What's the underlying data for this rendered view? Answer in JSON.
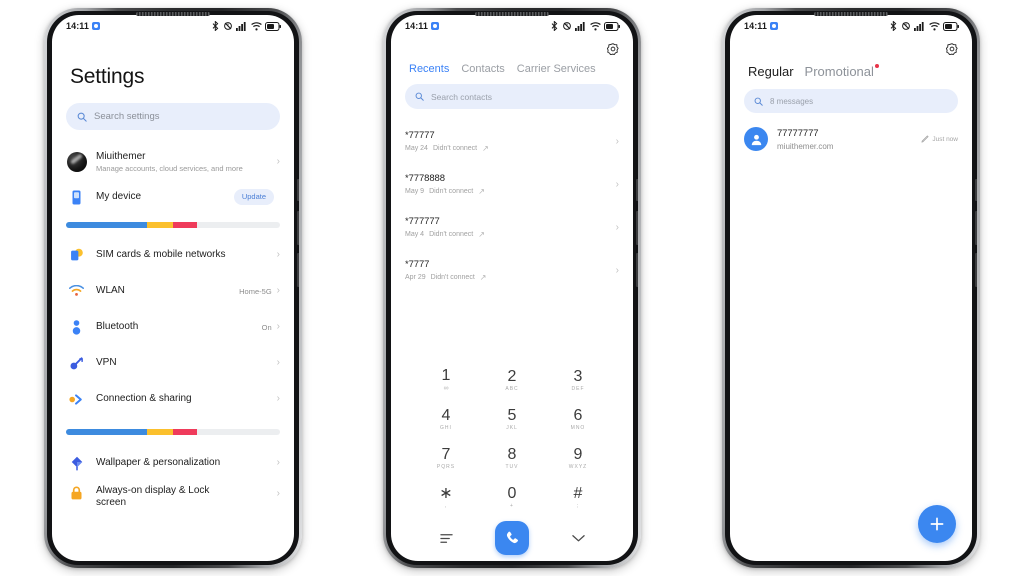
{
  "status_bar": {
    "time": "14:11",
    "left_icon": "app-badge-icon",
    "icons": [
      "bluetooth-icon",
      "vibrate-icon",
      "signal-icon",
      "wifi-icon",
      "battery-icon"
    ]
  },
  "colors": {
    "accent_blue": "#3b87f0",
    "search_bg": "#e8eefb",
    "bar_blue": "#3d8bdf",
    "bar_yellow": "#fbc02d",
    "bar_red": "#ef3b5b",
    "bar_track": "#eceef0",
    "red_dot": "#e8344a"
  },
  "settings": {
    "title": "Settings",
    "search": {
      "placeholder": "Search settings",
      "icon": "search-icon"
    },
    "account": {
      "name": "Miuithemer",
      "subtitle": "Manage accounts, cloud services, and more",
      "avatar": "account-avatar"
    },
    "device": {
      "label": "My device",
      "badge": "Update",
      "icon": "phone-icon"
    },
    "progress_bars": [
      {
        "segments": [
          38,
          12,
          11
        ],
        "track": 39
      },
      {
        "segments": [
          38,
          12,
          11
        ],
        "track": 39
      }
    ],
    "items": [
      {
        "label": "SIM cards & mobile networks",
        "value": "",
        "icon": "sim-card-icon"
      },
      {
        "label": "WLAN",
        "value": "Home-5G",
        "icon": "wifi-icon"
      },
      {
        "label": "Bluetooth",
        "value": "On",
        "icon": "bluetooth-icon"
      },
      {
        "label": "VPN",
        "value": "",
        "icon": "vpn-key-icon"
      },
      {
        "label": "Connection & sharing",
        "value": "",
        "icon": "connection-sharing-icon"
      }
    ],
    "items2": [
      {
        "label": "Wallpaper & personalization",
        "value": "",
        "icon": "wallpaper-icon"
      },
      {
        "label": "Always-on display & Lock screen",
        "value": "",
        "icon": "lock-icon"
      }
    ],
    "chevron": "›"
  },
  "dialer": {
    "gear": "settings-gear-icon",
    "tabs": [
      {
        "label": "Recents",
        "active": true
      },
      {
        "label": "Contacts",
        "active": false
      },
      {
        "label": "Carrier Services",
        "active": false
      }
    ],
    "search": {
      "placeholder": "Search contacts",
      "icon": "search-icon"
    },
    "calls": [
      {
        "number": "*77777",
        "date": "May 24",
        "status": "Didn't connect",
        "direction": "outgoing-call-icon"
      },
      {
        "number": "*7778888",
        "date": "May 9",
        "status": "Didn't connect",
        "direction": "outgoing-call-icon"
      },
      {
        "number": "*777777",
        "date": "May 4",
        "status": "Didn't connect",
        "direction": "outgoing-call-icon"
      },
      {
        "number": "*7777",
        "date": "Apr 29",
        "status": "Didn't connect",
        "direction": "outgoing-call-icon"
      }
    ],
    "keys": [
      {
        "num": "1",
        "sub": "∞",
        "voicemail": true
      },
      {
        "num": "2",
        "sub": "ABC"
      },
      {
        "num": "3",
        "sub": "DEF"
      },
      {
        "num": "4",
        "sub": "GHI"
      },
      {
        "num": "5",
        "sub": "JKL"
      },
      {
        "num": "6",
        "sub": "MNO"
      },
      {
        "num": "7",
        "sub": "PQRS"
      },
      {
        "num": "8",
        "sub": "TUV"
      },
      {
        "num": "9",
        "sub": "WXYZ"
      },
      {
        "num": "∗",
        "sub": ","
      },
      {
        "num": "0",
        "sub": "+"
      },
      {
        "num": "#",
        "sub": ";"
      }
    ],
    "bottom": {
      "left_icon": "menu-lines-icon",
      "call_icon": "call-handset-icon",
      "right_icon": "chevron-down-icon"
    },
    "chevron": "›"
  },
  "messages": {
    "gear": "settings-gear-icon",
    "tabs": [
      {
        "label": "Regular",
        "active": true,
        "dot": false
      },
      {
        "label": "Promotional",
        "active": false,
        "dot": true
      }
    ],
    "search": {
      "placeholder": "8 messages",
      "icon": "search-icon"
    },
    "threads": [
      {
        "name": "77777777",
        "preview": "miuithemer.com",
        "time": "Just now",
        "time_icon": "sent-pencil-icon",
        "avatar": "person-avatar-icon"
      }
    ],
    "fab": {
      "icon": "plus-icon"
    }
  }
}
